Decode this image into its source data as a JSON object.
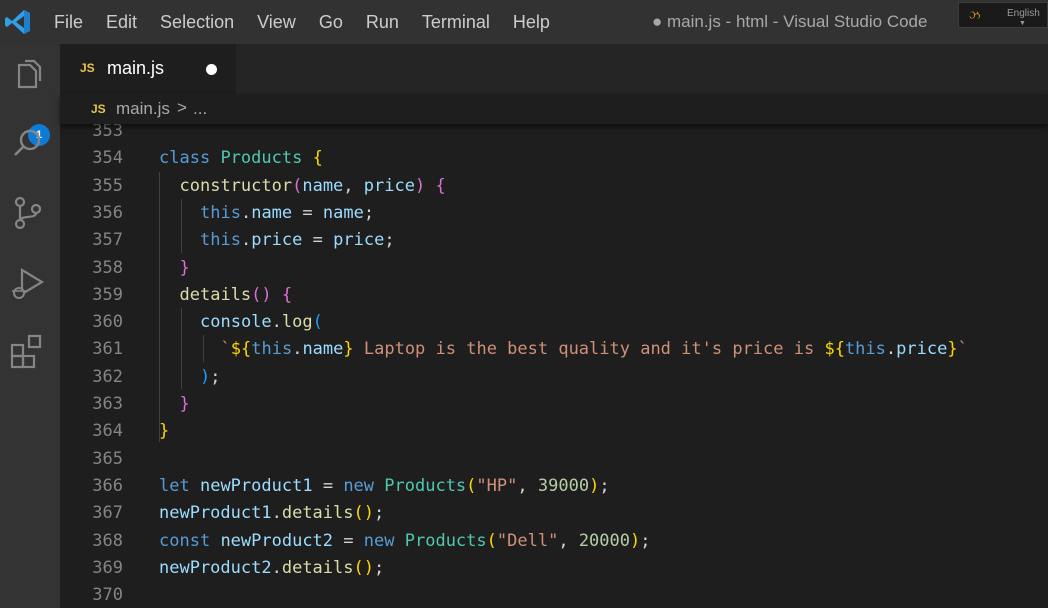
{
  "app": {
    "window_title": "● main.js - html - Visual Studio Code",
    "menu": [
      "File",
      "Edit",
      "Selection",
      "View",
      "Go",
      "Run",
      "Terminal",
      "Help"
    ],
    "language_indicator": "English"
  },
  "activity_bar": {
    "items": [
      "explorer-icon",
      "search-icon",
      "source-control-icon",
      "run-debug-icon",
      "extensions-icon"
    ],
    "explorer_badge": "1"
  },
  "tab": {
    "file_icon": "JS",
    "name": "main.js",
    "modified": true
  },
  "breadcrumb": {
    "file_icon": "JS",
    "file": "main.js",
    "separator": ">",
    "more": "..."
  },
  "editor": {
    "lines": [
      {
        "n": "353",
        "code": ""
      },
      {
        "n": "354",
        "code": "class Products {"
      },
      {
        "n": "355",
        "code": "  constructor(name, price) {"
      },
      {
        "n": "356",
        "code": "    this.name = name;"
      },
      {
        "n": "357",
        "code": "    this.price = price;"
      },
      {
        "n": "358",
        "code": "  }"
      },
      {
        "n": "359",
        "code": "  details() {"
      },
      {
        "n": "360",
        "code": "    console.log("
      },
      {
        "n": "361",
        "code": "      `${this.name} Laptop is the best quality and it's price is ${this.price}`"
      },
      {
        "n": "362",
        "code": "    );"
      },
      {
        "n": "363",
        "code": "  }"
      },
      {
        "n": "364",
        "code": "}"
      },
      {
        "n": "365",
        "code": ""
      },
      {
        "n": "366",
        "code": "let newProduct1 = new Products(\"HP\", 39000);"
      },
      {
        "n": "367",
        "code": "newProduct1.details();"
      },
      {
        "n": "368",
        "code": "const newProduct2 = new Products(\"Dell\", 20000);"
      },
      {
        "n": "369",
        "code": "newProduct2.details();"
      },
      {
        "n": "370",
        "code": ""
      }
    ]
  },
  "colors": {
    "keyword": "#569cd6",
    "class": "#4ec9b0",
    "function": "#dcdcaa",
    "variable": "#9cdcfe",
    "string": "#ce9178",
    "number": "#b5cea8",
    "bracket_1": "#ffd700",
    "bracket_2": "#da70d6",
    "bracket_3": "#179fff",
    "badge": "#0e7bd7",
    "js_icon": "#e6c54a"
  }
}
